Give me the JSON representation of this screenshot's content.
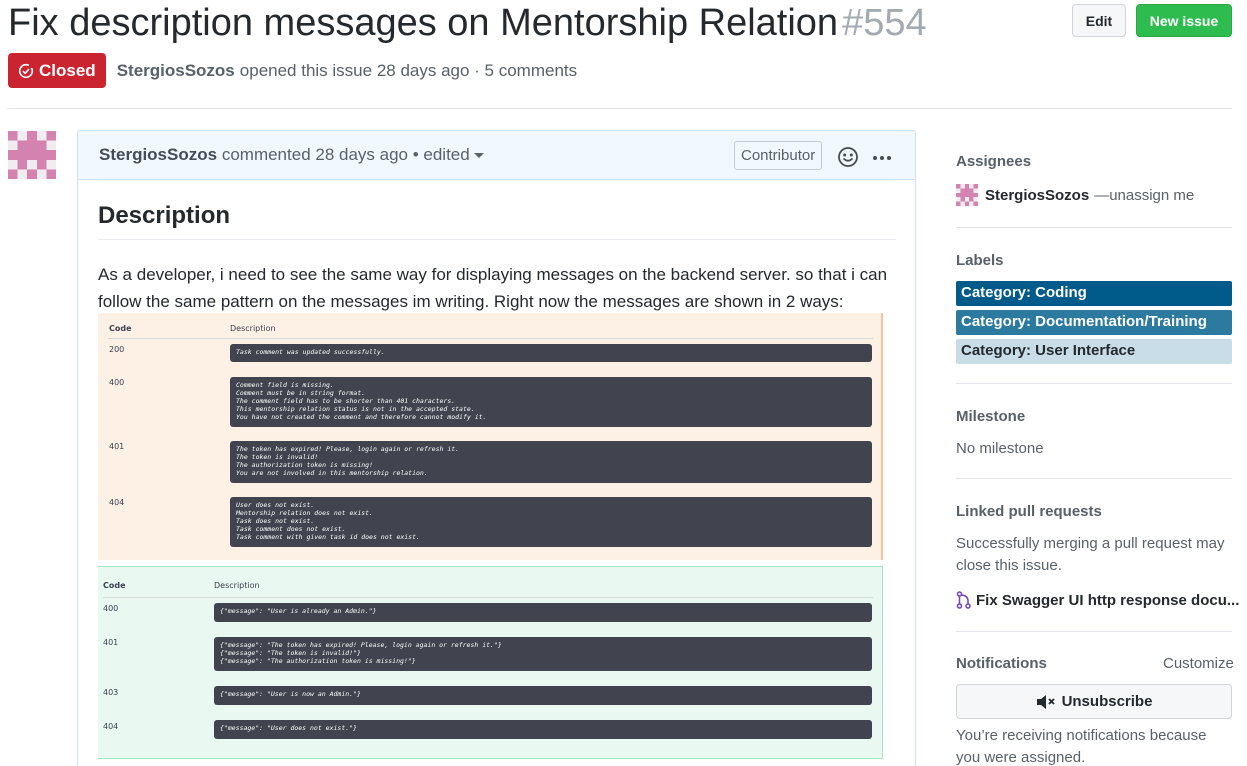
{
  "issue": {
    "title": "Fix description messages on Mentorship Relation",
    "number": "#554",
    "state": "Closed",
    "author": "StergiosSozos",
    "meta_text": "opened this issue 28 days ago · 5 comments"
  },
  "header_buttons": {
    "edit": "Edit",
    "new_issue": "New issue"
  },
  "comment": {
    "author": "StergiosSozos",
    "meta": "commented 28 days ago • edited",
    "badge": "Contributor",
    "heading": "Description",
    "body": "As a developer, i need to see the same way for displaying messages on the backend server. so that i can follow the same pattern on the messages im writing. Right now the messages are shown in 2 ways:"
  },
  "screenshot_1": {
    "col_code": "Code",
    "col_desc": "Description",
    "rows": [
      {
        "code": "200",
        "text": "Task comment was updated successfully."
      },
      {
        "code": "400",
        "text": "Comment field is missing.\nComment must be in string format.\nThe comment field has to be shorter than 401 characters.\nThis mentorship relation status is not in the accepted state.\nYou have not created the comment and therefore cannot modify it."
      },
      {
        "code": "401",
        "text": "The token has expired! Please, login again or refresh it.\nThe token is invalid!\nThe authorization token is missing!\nYou are not involved in this mentorship relation."
      },
      {
        "code": "404",
        "text": "User does not exist.\nMentorship relation does not exist.\nTask does not exist.\nTask comment does not exist.\nTask comment with given task id does not exist."
      }
    ]
  },
  "screenshot_2": {
    "col_code": "Code",
    "col_desc": "Description",
    "rows": [
      {
        "code": "400",
        "text": "{\"message\": \"User is already an Admin.\"}"
      },
      {
        "code": "401",
        "text": "{\"message\": \"The token has expired! Please, login again or refresh it.\"}\n{\"message\": \"The token is invalid!\"}\n{\"message\": \"The authorization token is missing!\"}"
      },
      {
        "code": "403",
        "text": "{\"message\": \"User is now an Admin.\"}"
      },
      {
        "code": "404",
        "text": "{\"message\": \"User does not exist.\"}"
      }
    ]
  },
  "sidebar": {
    "assignees": {
      "heading": "Assignees",
      "name": "StergiosSozos",
      "action": "—unassign me"
    },
    "labels": {
      "heading": "Labels",
      "items": [
        {
          "name": "Category: Coding",
          "color": "#005a8a",
          "text_color": "#ffffff"
        },
        {
          "name": "Category: Documentation/Training",
          "color": "#2c7aa0",
          "text_color": "#ffffff"
        },
        {
          "name": "Category: User Interface",
          "color": "#c9dde8",
          "text_color": "#24292e"
        }
      ]
    },
    "milestone": {
      "heading": "Milestone",
      "value": "No milestone"
    },
    "linked_prs": {
      "heading": "Linked pull requests",
      "note": "Successfully merging a pull request may close this issue.",
      "pr_title": "Fix Swagger UI http response docu..."
    },
    "notifications": {
      "heading": "Notifications",
      "customize": "Customize",
      "button": "Unsubscribe",
      "note": "You’re receiving notifications because you were assigned."
    }
  },
  "colors": {
    "closed_red": "#cb2431",
    "new_issue_green": "#2ebc4f",
    "avatar_pink": "#d483b0"
  }
}
